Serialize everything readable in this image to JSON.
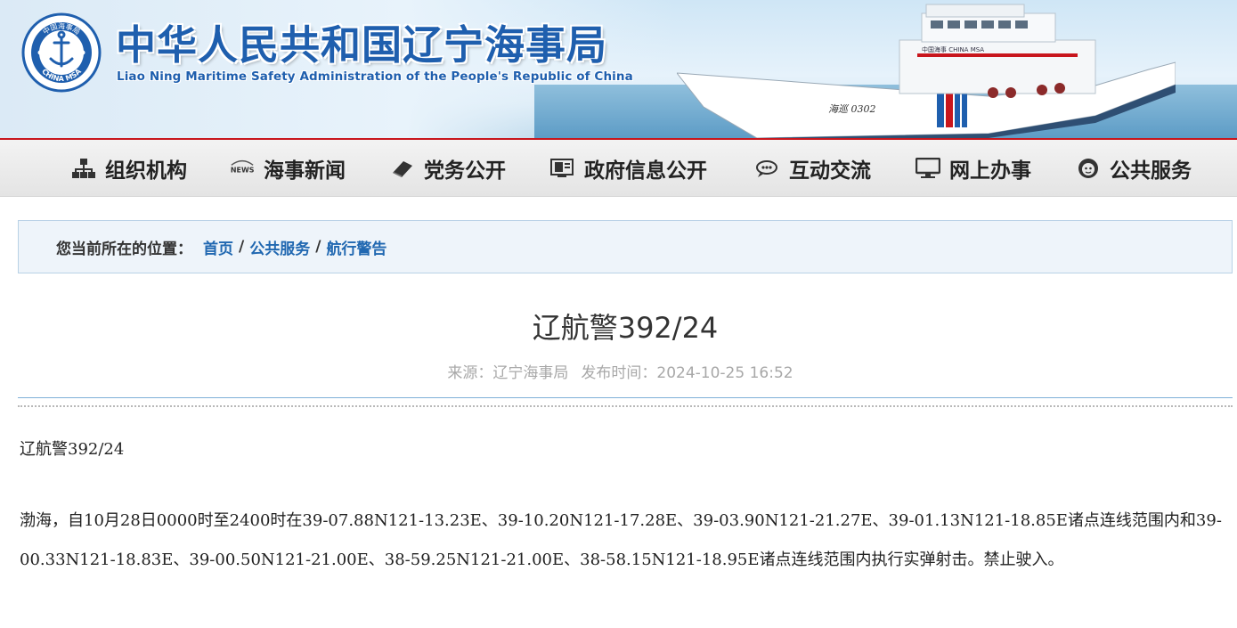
{
  "header": {
    "title_cn": "中华人民共和国辽宁海事局",
    "title_en": "Liao Ning Maritime Safety Administration of the People's Republic of China",
    "emblem_text_top": "中国海事局",
    "emblem_text_bottom": "CHINA MSA",
    "ship_hull_text": "海巡 0302",
    "ship_cabin_text": "中国海事 CHINA MSA"
  },
  "nav": {
    "items": [
      {
        "label": "组织机构",
        "icon": "org-chart-icon"
      },
      {
        "label": "海事新闻",
        "icon": "news-icon"
      },
      {
        "label": "党务公开",
        "icon": "book-icon"
      },
      {
        "label": "政府信息公开",
        "icon": "monitor-document-icon"
      },
      {
        "label": "互动交流",
        "icon": "chat-icon"
      },
      {
        "label": "网上办事",
        "icon": "computer-icon"
      },
      {
        "label": "公共服务",
        "icon": "service-person-icon"
      }
    ]
  },
  "breadcrumb": {
    "prefix": "您当前所在的位置：",
    "items": [
      "首页",
      "公共服务",
      "航行警告"
    ],
    "separator": "/"
  },
  "article": {
    "title": "辽航警392/24",
    "source_label": "来源：辽宁海事局",
    "publish_label": "发布时间：2024-10-25 16:52",
    "body_title": "辽航警392/24",
    "body": "渤海，自10月28日0000时至2400时在39-07.88N121-13.23E、39-10.20N121-17.28E、39-03.90N121-21.27E、39-01.13N121-18.85E诸点连线范围内和39-00.33N121-18.83E、39-00.50N121-21.00E、38-59.25N121-21.00E、38-58.15N121-18.95E诸点连线范围内执行实弹射击。禁止驶入。"
  },
  "colors": {
    "brand_blue": "#1f5fae",
    "accent_red": "#c8161d",
    "link_blue": "#2168b1"
  }
}
